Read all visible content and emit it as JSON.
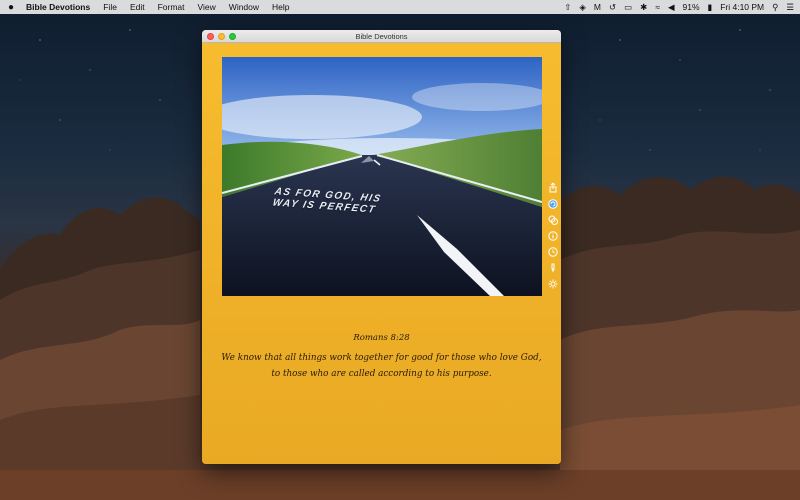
{
  "menubar": {
    "app_name": "Bible Devotions",
    "menus": [
      "File",
      "Edit",
      "Format",
      "View",
      "Window",
      "Help"
    ],
    "battery": "91%",
    "clock": "Fri 4:10 PM"
  },
  "window": {
    "title": "Bible Devotions"
  },
  "devotion": {
    "image_caption_line1": "AS FOR GOD, HIS",
    "image_caption_line2": "WAY IS PERFECT",
    "reference": "Romans 8:28",
    "verse": "We know that all things work together for good for those who love God, to those who are called according to his purpose."
  },
  "tools": [
    "share-icon",
    "refresh-icon",
    "copy-icon",
    "info-icon",
    "clock-icon",
    "brush-icon",
    "settings-icon"
  ],
  "colors": {
    "window_background": "#f0b52a",
    "verse_text": "#2a1a08"
  }
}
